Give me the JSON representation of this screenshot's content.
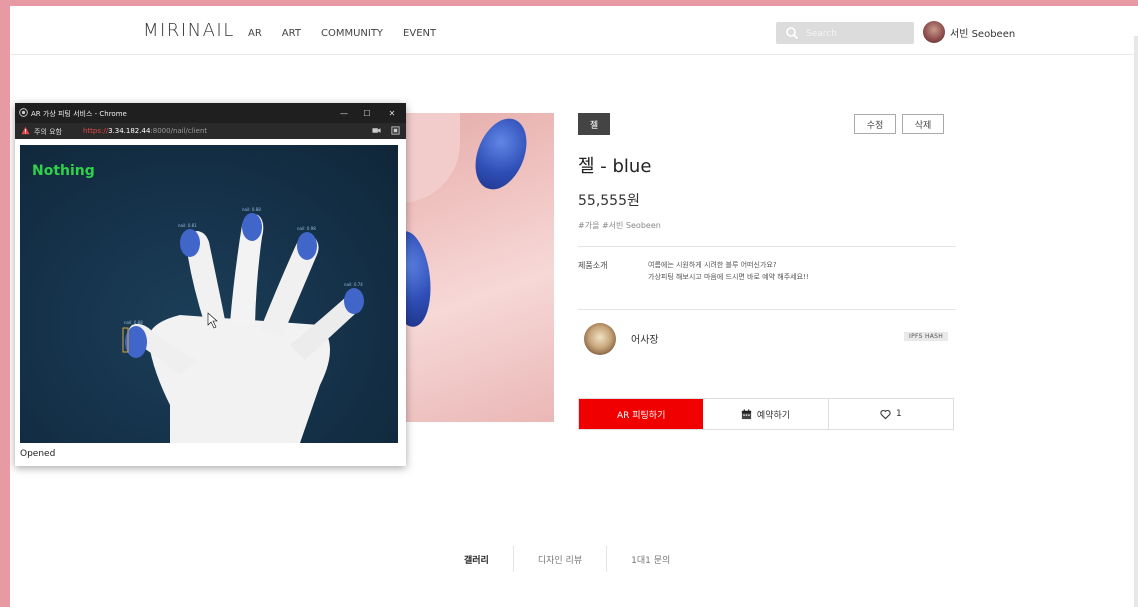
{
  "header": {
    "logo": "MIRINAIL",
    "nav": [
      "AR",
      "ART",
      "COMMUNITY",
      "EVENT"
    ],
    "search_placeholder": "Search",
    "user_name": "서빈 Seobeen"
  },
  "popup": {
    "window_title": "AR 가상 피팅 서비스 - Chrome",
    "security_warning": "주의 요함",
    "url_scheme": "https://",
    "url_host": "3.34.182.44",
    "url_rest": ":8000/nail/client",
    "detection_status": "Nothing",
    "nail_labels": [
      "nail: 0.88",
      "nail: 0.81",
      "nail: 0.88",
      "nail: 0.98",
      "nail: 0.74"
    ],
    "stream_status": "Opened",
    "window_controls": {
      "minimize": "—",
      "maximize": "☐",
      "close": "✕"
    }
  },
  "product": {
    "category": "젤",
    "edit_label": "수정",
    "delete_label": "삭제",
    "title": "젤 - blue",
    "price": "55,555원",
    "tags": "#가을 #서빈 Seobeen",
    "intro_label": "제품소개",
    "intro_lines": [
      "여름에는 시원하게 시려한 블루 어떠신가요?",
      "가상피팅 해보시고 마음에 드시면 바로 예약 해주세요!!"
    ],
    "shop_name": "어사장",
    "hash_badge": "IPFS HASH",
    "ar_button": "AR 피팅하기",
    "reserve_button": "예약하기",
    "like_count": "1"
  },
  "tabs": [
    "갤러리",
    "디자인 리뷰",
    "1대1 문의"
  ],
  "colors": {
    "accent_red": "#f10000",
    "frame_pink": "#e79aa3",
    "detect_green": "#2fd14a",
    "nail_blue": "#2f4eb6"
  }
}
